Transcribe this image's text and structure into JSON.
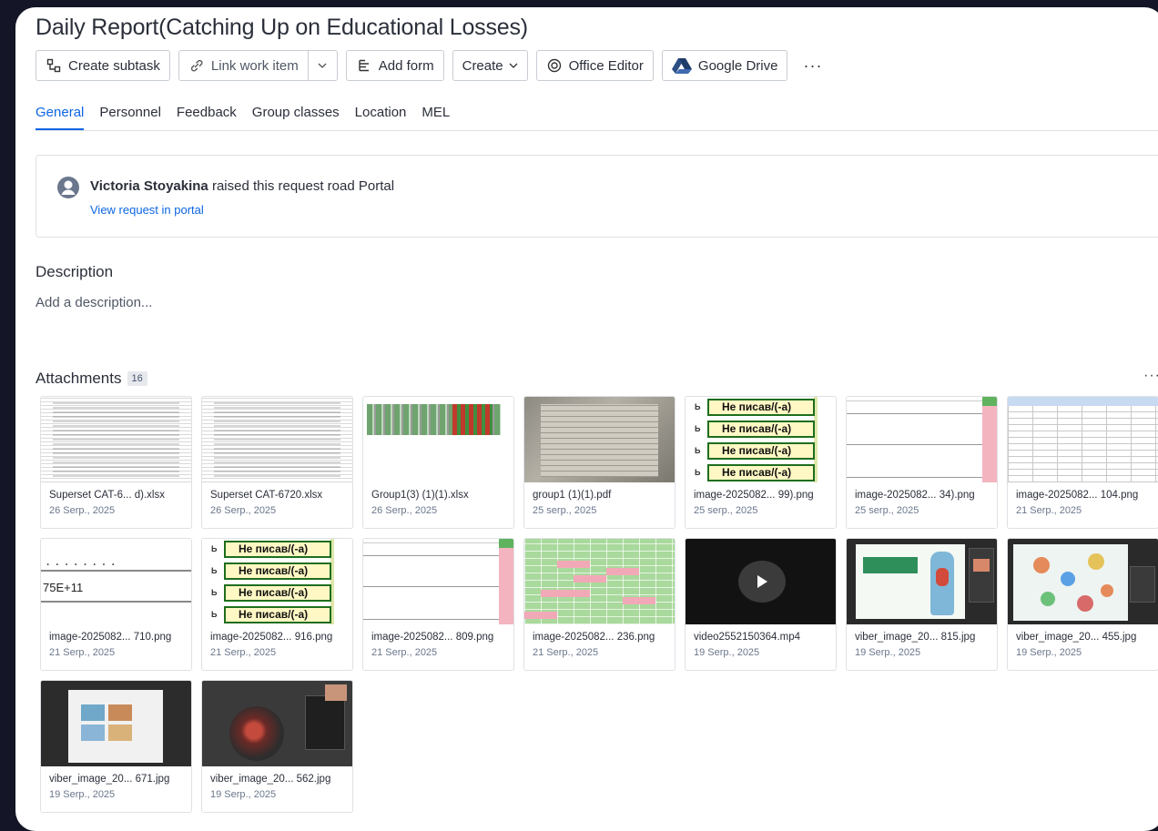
{
  "header": {
    "title": "Daily Report(Catching Up on Educational Losses)"
  },
  "toolbar": {
    "create_subtask": "Create subtask",
    "link_work_item": "Link work item",
    "add_form": "Add form",
    "create": "Create",
    "office_editor": "Office Editor",
    "google_drive": "Google Drive",
    "more": "···"
  },
  "tabs": [
    {
      "label": "General",
      "active": true
    },
    {
      "label": "Personnel"
    },
    {
      "label": "Feedback"
    },
    {
      "label": "Group classes"
    },
    {
      "label": "Location"
    },
    {
      "label": "MEL"
    }
  ],
  "request": {
    "user": "Victoria Stoyakina",
    "text": " raised this request road Portal",
    "link": "View request in portal"
  },
  "description": {
    "heading": "Description",
    "placeholder": "Add a description..."
  },
  "attachments": {
    "heading": "Attachments",
    "count": "16",
    "more": "···",
    "thumb_text": {
      "ne_pisav": "Не писав/(-а)",
      "e11": "75E+11",
      "dots": "........"
    },
    "items": [
      {
        "name": "Superset CAT-6... d).xlsx",
        "date": "26 Serp., 2025"
      },
      {
        "name": "Superset CAT-6720.xlsx",
        "date": "26 Serp., 2025"
      },
      {
        "name": "Group1(3) (1)(1).xlsx",
        "date": "26 Serp., 2025"
      },
      {
        "name": "group1 (1)(1).pdf",
        "date": "25 serp., 2025"
      },
      {
        "name": "image-2025082... 99).png",
        "date": "25 serp., 2025"
      },
      {
        "name": "image-2025082... 34).png",
        "date": "25 serp., 2025"
      },
      {
        "name": "image-2025082... 104.png",
        "date": "21 Serp., 2025"
      },
      {
        "name": "image-2025082... 710.png",
        "date": "21 Serp., 2025"
      },
      {
        "name": "image-2025082... 916.png",
        "date": "21 Serp., 2025"
      },
      {
        "name": "image-2025082... 809.png",
        "date": "21 Serp., 2025"
      },
      {
        "name": "image-2025082... 236.png",
        "date": "21 Serp., 2025"
      },
      {
        "name": "video2552150364.mp4",
        "date": "19 Serp., 2025"
      },
      {
        "name": "viber_image_20... 815.jpg",
        "date": "19 Serp., 2025"
      },
      {
        "name": "viber_image_20... 455.jpg",
        "date": "19 Serp., 2025"
      },
      {
        "name": "viber_image_20... 671.jpg",
        "date": "19 Serp., 2025"
      },
      {
        "name": "viber_image_20... 562.jpg",
        "date": "19 Serp., 2025"
      }
    ]
  },
  "colors": {
    "accent": "#0c66e4",
    "background": "#141526",
    "panel": "#ffffff"
  }
}
